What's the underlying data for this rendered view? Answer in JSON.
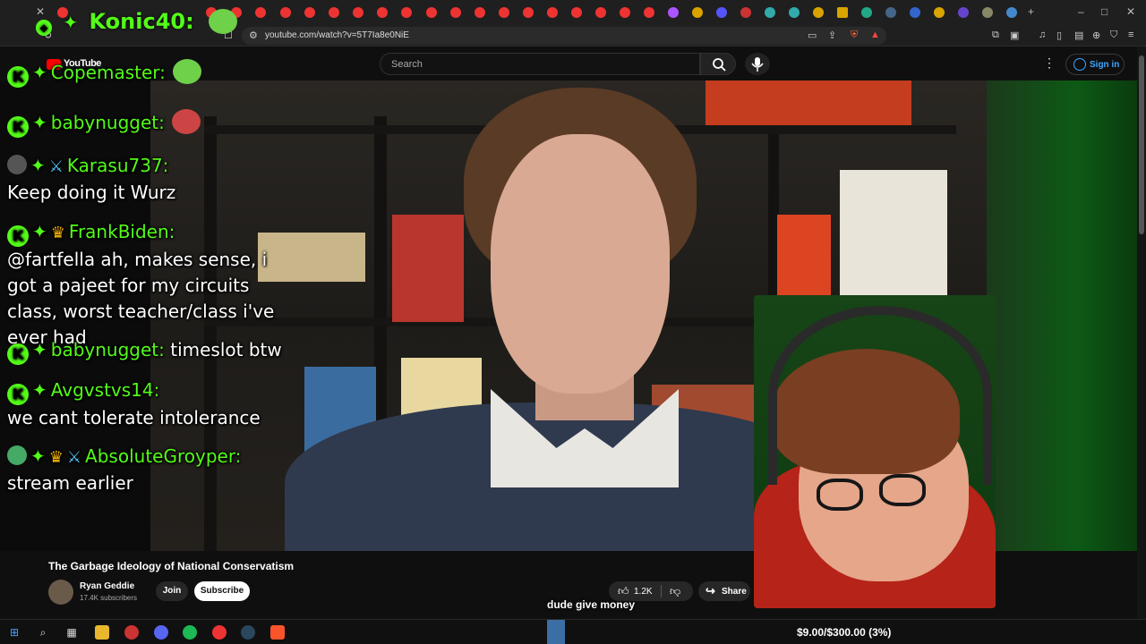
{
  "browser": {
    "url": "youtube.com/watch?v=5T7Ia8e0NiE"
  },
  "youtube": {
    "logo_text": "YouTube",
    "search_placeholder": "Search",
    "signin_label": "Sign in"
  },
  "chat": {
    "top_user": "Konic40:",
    "messages": [
      {
        "user": "Copemaster:",
        "text": ""
      },
      {
        "user": "babynugget:",
        "text": ""
      },
      {
        "user": "Karasu737:",
        "text": "Keep doing it Wurz"
      },
      {
        "user": "FrankBiden:",
        "text": "@fartfella ah, makes sense, i got a pajeet for my circuits class, worst teacher/class i've ever had"
      },
      {
        "user": "babynugget:",
        "text": "timeslot btw"
      },
      {
        "user": "Avgvstvs14:",
        "text": "we cant tolerate intolerance"
      },
      {
        "user": "AbsoluteGroyper:",
        "text": "stream earlier"
      }
    ]
  },
  "video": {
    "title": "The Garbage Ideology of National Conservatism",
    "channel_name": "Ryan Geddie",
    "subscribers": "17.4K subscribers",
    "join_label": "Join",
    "subscribe_label": "Subscribe",
    "like_count": "1.2K",
    "share_label": "Share"
  },
  "overlay": {
    "caption": "dude give money",
    "donation_goal": "$9.00/$300.00 (3%)",
    "donation_fraction": 0.03
  },
  "colors": {
    "kick_green": "#53fc18",
    "yt_red": "#ff0000",
    "link_blue": "#3ea6ff"
  }
}
